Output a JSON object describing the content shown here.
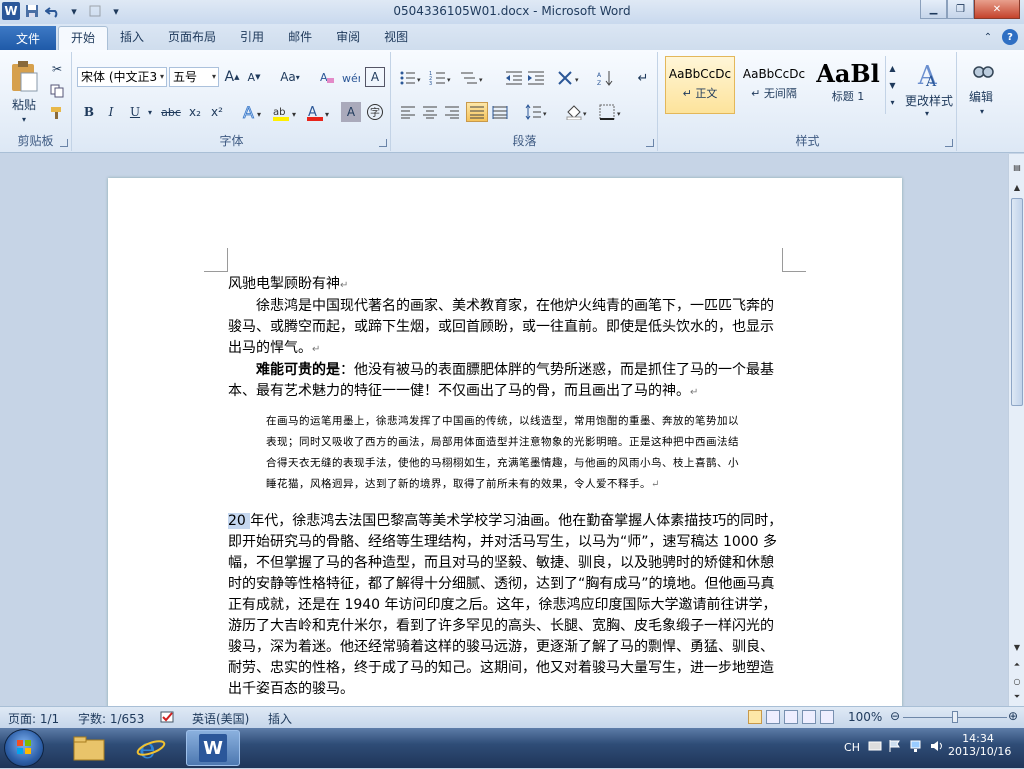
{
  "window": {
    "title": "0504336105W01.docx - Microsoft Word",
    "logo": "W"
  },
  "qat": {
    "icons": [
      "word-logo-icon",
      "save-icon",
      "undo-icon",
      "redo-icon",
      "customize-icon"
    ]
  },
  "tabs": {
    "file": "文件",
    "items": [
      "开始",
      "插入",
      "页面布局",
      "引用",
      "邮件",
      "审阅",
      "视图"
    ],
    "active": "开始"
  },
  "ribbon": {
    "clipboard": {
      "label": "剪贴板",
      "paste": "粘贴"
    },
    "font": {
      "label": "字体",
      "font_name": "宋体 (中文正3",
      "font_size": "五号",
      "grow": "A",
      "shrink": "A",
      "case": "Aa",
      "bold": "B",
      "italic": "I",
      "underline": "U",
      "strike": "abc",
      "subscript": "x₂",
      "superscript": "x²"
    },
    "paragraph": {
      "label": "段落"
    },
    "styles": {
      "label": "样式",
      "items": [
        {
          "sample": "AaBbCcDc",
          "name": "↵ 正文",
          "selected": true
        },
        {
          "sample": "AaBbCcDc",
          "name": "↵ 无间隔",
          "selected": false
        },
        {
          "sample": "AaBl",
          "name": "标题 1",
          "selected": false
        }
      ],
      "change_styles": "更改样式"
    },
    "editing": {
      "label": "编辑"
    }
  },
  "document": {
    "title_line": "风驰电掣顾盼有神",
    "p1": "徐悲鸿是中国现代著名的画家、美术教育家，在他炉火纯青的画笔下，一匹匹飞奔的骏马、或腾空而起，或蹄下生烟，或回首顾盼，或一往直前。即使是低头饮水的，也显示出马的悍气。",
    "p2_bold": "难能可贵的是",
    "p2_rest": "：他没有被马的表面膘肥体胖的气势所迷惑，而是抓住了马的一个最基本、最有艺术魅力的特征一一健！不仅画出了马的骨，而且画出了马的神。",
    "quote": "在画马的运笔用墨上，徐悲鸿发挥了中国画的传统，以线造型，常用饱酣的重墨、奔放的笔势加以表现；同时又吸收了西方的画法，局部用体面造型并注意物象的光影明暗。正是这种把中西画法结合得天衣无缝的表现手法，使他的马栩栩如生，充满笔墨情趣，与他画的风雨小鸟、枝上喜鹊、小睡花猫，风格迥异，达到了新的境界，取得了前所未有的效果，令人爱不释手。",
    "p3_hl": "20 ",
    "p3": "年代，徐悲鸿去法国巴黎高等美术学校学习油画。他在勤奋掌握人体素描技巧的同时，即开始研究马的骨骼、经络等生理结构，并对活马写生，以马为“师”，速写稿达 1000 多幅，不但掌握了马的各种造型，而且对马的坚毅、敏捷、驯良，以及驰骋时的矫健和休憩时的安静等性格特征，都了解得十分细腻、透彻，达到了“胸有成马”的境地。但他画马真正有成就，还是在 1940 年访问印度之后。这年，徐悲鸿应印度国际大学邀请前往讲学，游历了大吉岭和克什米尔，看到了许多罕见的高头、长腿、宽胸、皮毛象缎子一样闪光的骏马，深为着迷。他还经常骑着这样的骏马远游，更逐渐了解了马的剽悍、勇猛、驯良、耐劳、忠实的性格，终于成了马的知己。这期间，他又对着骏马大量写生，进一步地塑造出千姿百态的骏马。"
  },
  "status": {
    "page": "页面: 1/1",
    "words": "字数: 1/653",
    "language": "英语(美国)",
    "mode": "插入",
    "zoom": "100%"
  },
  "tray": {
    "lang": "CH",
    "time": "14:34",
    "date": "2013/10/16"
  }
}
